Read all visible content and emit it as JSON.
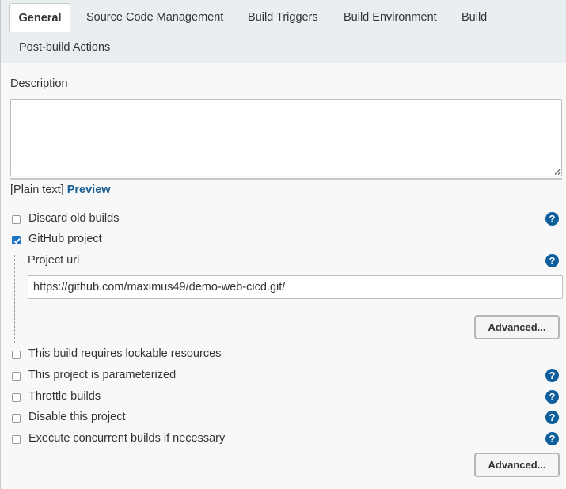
{
  "tabs": [
    {
      "label": "General",
      "active": true
    },
    {
      "label": "Source Code Management"
    },
    {
      "label": "Build Triggers"
    },
    {
      "label": "Build Environment"
    },
    {
      "label": "Build"
    },
    {
      "label": "Post-build Actions"
    }
  ],
  "description": {
    "label": "Description",
    "value": "",
    "format_text": "[Plain text]",
    "preview_label": "Preview"
  },
  "options": {
    "discard_old_builds": {
      "label": "Discard old builds",
      "checked": false
    },
    "github_project": {
      "label": "GitHub project",
      "checked": true,
      "project_url_label": "Project url",
      "project_url_value": "https://github.com/maximus49/demo-web-cicd.git/",
      "advanced_label": "Advanced..."
    },
    "lockable_resources": {
      "label": "This build requires lockable resources",
      "checked": false
    },
    "parameterized": {
      "label": "This project is parameterized",
      "checked": false
    },
    "throttle_builds": {
      "label": "Throttle builds",
      "checked": false
    },
    "disable_project": {
      "label": "Disable this project",
      "checked": false
    },
    "concurrent_builds": {
      "label": "Execute concurrent builds if necessary",
      "checked": false
    }
  },
  "advanced_button_label": "Advanced...",
  "icons": {
    "help": "help-icon",
    "check": "check-icon"
  },
  "colors": {
    "accent": "#1a5f93",
    "help": "#0e5e9b",
    "checkbox_checked": "#1a73c9"
  }
}
